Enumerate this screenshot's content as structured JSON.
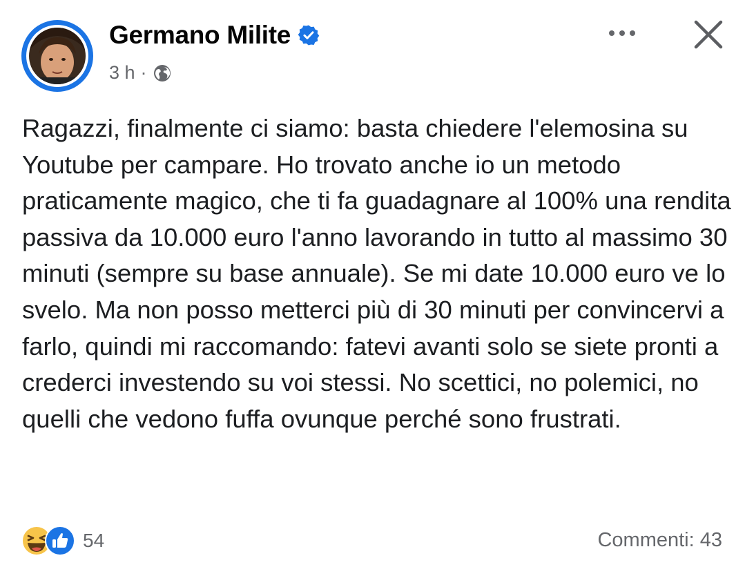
{
  "post": {
    "author": "Germano Milite",
    "time": "3 h",
    "separator": "·",
    "body": "Ragazzi, finalmente ci siamo: basta chiedere l'elemosina su Youtube per campare. Ho trovato anche io un metodo praticamente magico, che ti fa guadagnare al 100% una rendita passiva da 10.000 euro l'anno lavorando in tutto al massimo 30 minuti (sempre su base annuale). Se mi date 10.000 euro ve lo svelo. Ma non posso metterci più di 30 minuti per convincervi a farlo, quindi mi raccomando: fatevi avanti solo se siete pronti a crederci investendo su voi stessi. No scettici, no polemici, no quelli che vedono fuffa ovunque perché sono frustrati."
  },
  "icons": {
    "avatar": "profile-photo",
    "verified": "verified-badge-icon",
    "audience": "globe-icon",
    "more": "more-options-icon",
    "close": "close-icon",
    "reaction_1": "haha-reaction-icon",
    "reaction_2": "like-reaction-icon"
  },
  "footer": {
    "reaction_count": "54",
    "comments": "Commenti: 43"
  },
  "colors": {
    "brand_blue": "#1b74e4",
    "text": "#1c1e21",
    "secondary_text": "#65676b",
    "haha_yellow": "#f7c44a"
  }
}
